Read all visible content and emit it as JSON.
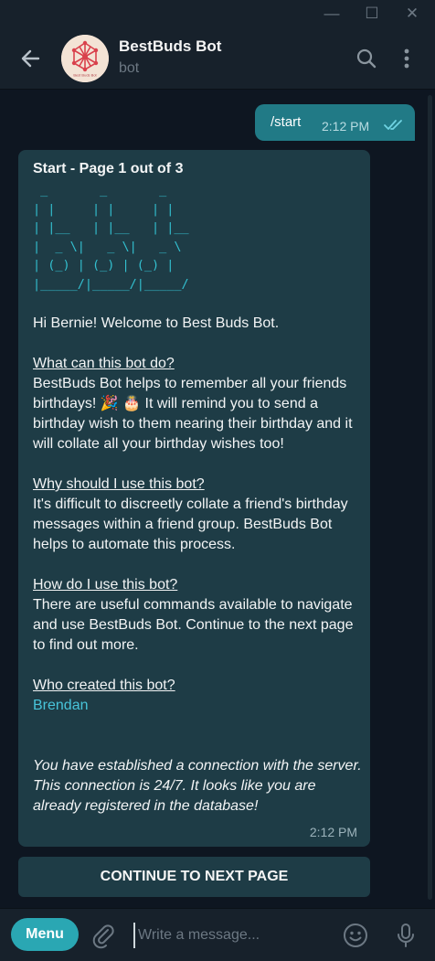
{
  "window": {
    "minimize_glyph": "—",
    "maximize_glyph": "☐",
    "close_glyph": "✕"
  },
  "header": {
    "title": "BestBuds Bot",
    "subtitle": "bot",
    "avatar_text": "Best Buds Bot"
  },
  "messages": {
    "outgoing": {
      "text": "/start",
      "time": "2:12 PM"
    },
    "incoming": {
      "title": "Start - Page 1 out of 3",
      "ascii_art": " _       _       _\n| |     | |     | |\n| |__   | |__   | |__\n|  _ \\|   _ \\|   _ \\\n| (_) | (_) | (_) |\n|_____/|_____/|_____/",
      "greeting": "Hi Bernie! Welcome to Best Buds Bot.",
      "section1_heading": "What can this bot do?",
      "section1_text": "BestBuds Bot helps to remember all your friends birthdays! 🎉 🎂 It will remind you to send a birthday wish to them nearing their birthday and it will collate all your birthday wishes too!",
      "section2_heading": "Why should I use this bot?",
      "section2_text": "It's difficult to discreetly collate a friend's birthday messages within a friend group. BestBuds Bot helps to automate this process.",
      "section3_heading": "How do I use this bot?",
      "section3_text": "There are useful commands available to navigate and use BestBuds Bot. Continue to the next page to find out more.",
      "section4_heading": "Who created this bot?",
      "creator_link": "Brendan",
      "footer_note": "You have established a connection with the server. This connection is 24/7. It looks like you are already registered in the database!",
      "time": "2:12 PM"
    },
    "inline_button": "CONTINUE TO NEXT PAGE"
  },
  "input_bar": {
    "menu_label": "Menu",
    "placeholder": "Write a message..."
  },
  "colors": {
    "background": "#0e1621",
    "panel": "#17212b",
    "outgoing_bubble": "#217a86",
    "incoming_bubble": "#1e3c46",
    "accent": "#2aa7b3",
    "link": "#48c4da",
    "ascii": "#33c0d0"
  },
  "icons": [
    "minimize-icon",
    "maximize-icon",
    "close-icon",
    "back-arrow-icon",
    "search-icon",
    "more-vertical-icon",
    "double-check-icon",
    "attach-icon",
    "emoji-icon",
    "microphone-icon"
  ]
}
